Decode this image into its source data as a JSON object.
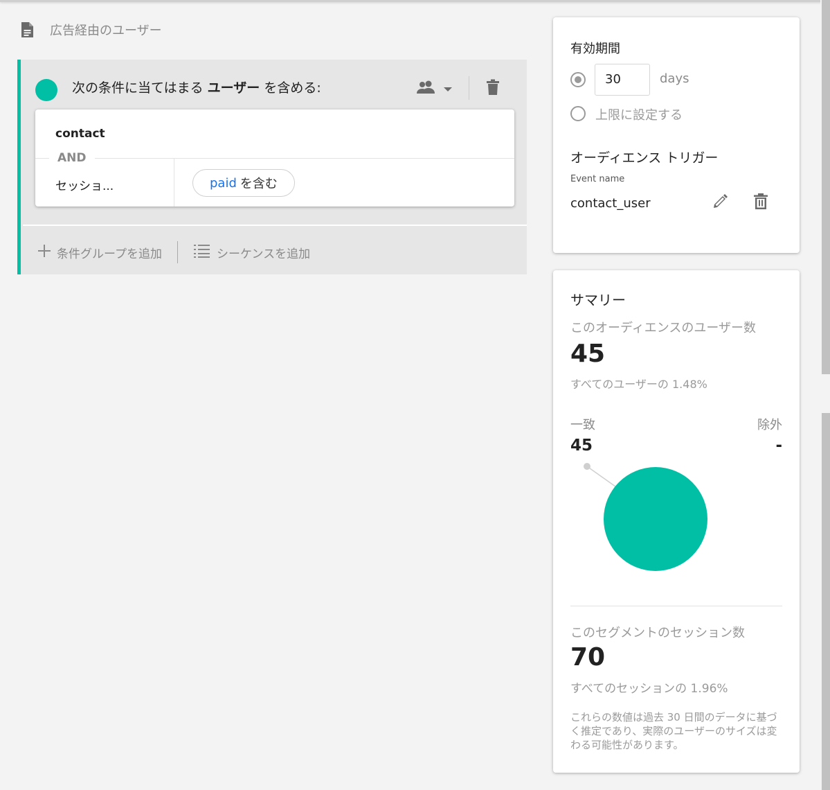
{
  "header": {
    "title": "広告経由のユーザー",
    "icon": "document-icon"
  },
  "group": {
    "accent_color": "#00bfa5",
    "headline_prefix": "次の条件に当てはまる",
    "headline_scope": "ユーザー",
    "headline_suffix": "を含める:",
    "condition": {
      "event_title": "contact",
      "operator": "AND",
      "field": "セッショ...",
      "chip_value": "paid",
      "chip_suffix": "を含む"
    },
    "actions": {
      "add_condition_group": "条件グループを追加",
      "add_sequence": "シーケンスを追加"
    }
  },
  "validity": {
    "title": "有効期間",
    "days_value": "30",
    "days_unit": "days",
    "unlimited_label": "上限に設定する",
    "selected_option": "days",
    "trigger_title": "オーディエンス トリガー",
    "event_name_label": "Event name",
    "event_name_value": "contact_user"
  },
  "summary": {
    "title": "サマリー",
    "users_label": "このオーディエンスのユーザー数",
    "users_count": "45",
    "users_share": "すべてのユーザーの 1.48%",
    "match_label": "一致",
    "exclude_label": "除外",
    "match_value": "45",
    "exclude_value": "-",
    "sessions_label": "このセグメントのセッション数",
    "sessions_count": "70",
    "sessions_share": "すべてのセッションの 1.96%",
    "note": "これらの数値は過去 30 日間のデータに基づく推定であり、実際のユーザーのサイズは変わる可能性があります。"
  },
  "chart_data": {
    "type": "pie",
    "categories": [
      "一致",
      "除外"
    ],
    "values": [
      45,
      0
    ],
    "colors": [
      "#00bfa5",
      "#cfcfcf"
    ]
  }
}
